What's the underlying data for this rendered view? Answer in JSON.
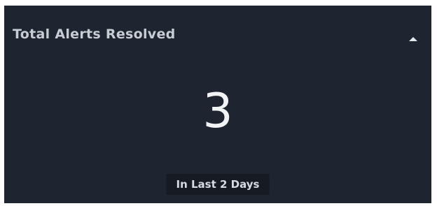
{
  "widget": {
    "title": "Total Alerts Resolved",
    "value": "3",
    "period_label": "In Last 2 Days",
    "collapse_icon": "caret-up-icon"
  },
  "colors": {
    "panel_background": "#1e2430",
    "title_text": "#c8ccd3",
    "value_text": "#f2f3f5",
    "period_background": "#161b23"
  }
}
